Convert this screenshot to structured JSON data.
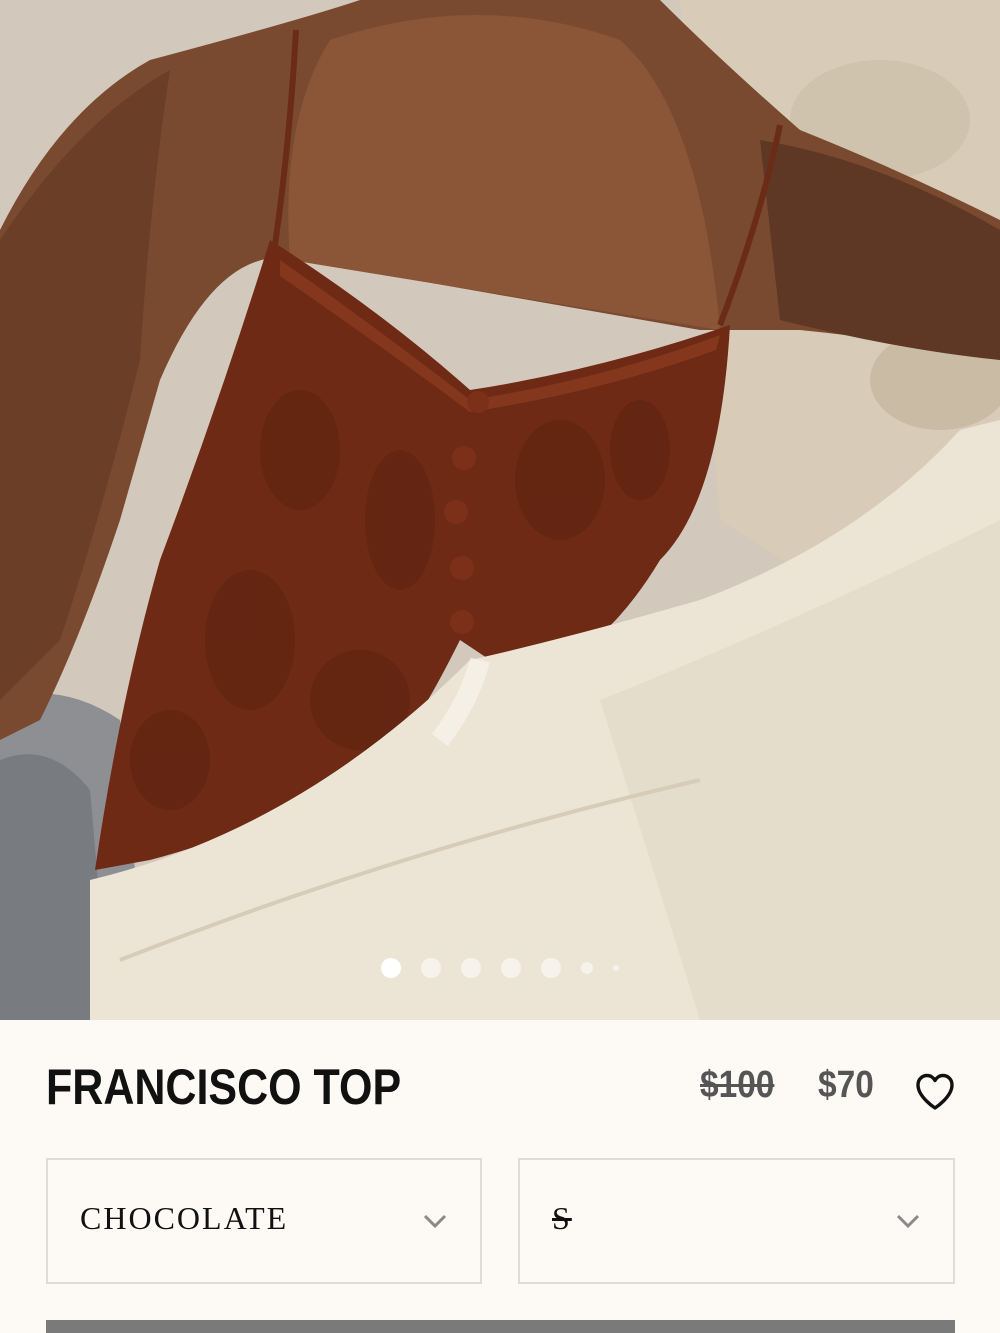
{
  "product": {
    "title": "FRANCISCO TOP",
    "price_original": "$100",
    "price_sale": "$70"
  },
  "gallery": {
    "image_alt": "Model wearing a chocolate crochet knit camisole top with button front and cream trousers",
    "dot_count": 7,
    "active_index": 0
  },
  "options": {
    "color_value": "CHOCOLATE",
    "size_value": "S"
  },
  "icons": {
    "wishlist": "heart-icon",
    "dropdown": "chevron-down-icon"
  },
  "colors": {
    "background": "#fdfaf6",
    "text": "#111111",
    "price": "#555555",
    "button": "#7a7a7a"
  }
}
